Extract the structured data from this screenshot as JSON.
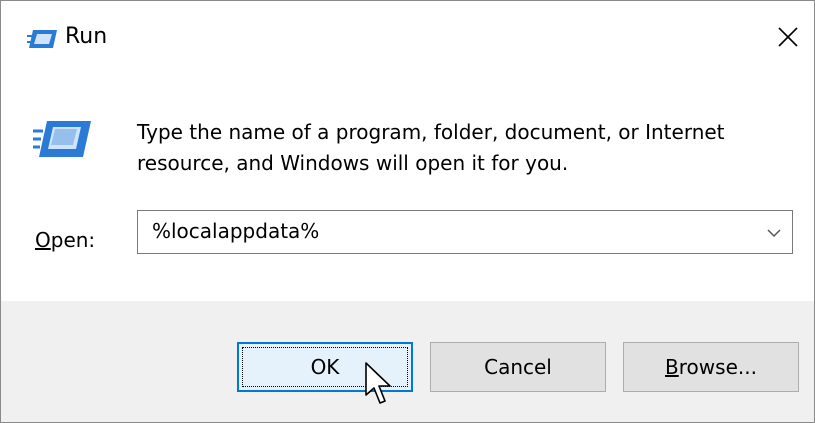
{
  "window": {
    "title": "Run",
    "close_glyph": "✕"
  },
  "content": {
    "description": "Type the name of a program, folder, document, or Internet resource, and Windows will open it for you.",
    "open_label_underlined": "O",
    "open_label_rest": "pen:",
    "open_value": "%localappdata%"
  },
  "buttons": {
    "ok_label": "OK",
    "cancel_label": "Cancel",
    "browse_underlined": "B",
    "browse_rest": "rowse..."
  },
  "icons": {
    "title_icon": "run-icon",
    "large_icon": "run-icon",
    "close_icon": "close-icon",
    "chevron_icon": "chevron-down-icon",
    "cursor_icon": "mouse-pointer-icon"
  },
  "colors": {
    "accent": "#0078d7",
    "icon_blue": "#2b7ad6",
    "footer_bg": "#f0f0f0",
    "button_bg": "#e1e1e1"
  }
}
